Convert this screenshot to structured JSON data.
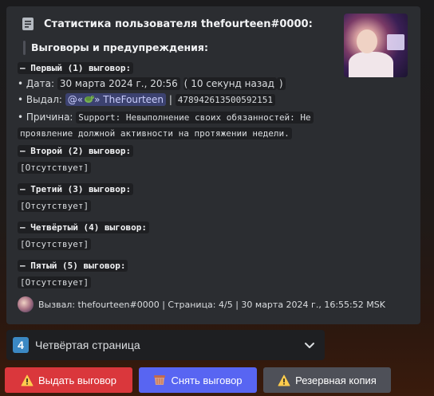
{
  "embed": {
    "author": "Статистика пользователя thefourteen#0000:",
    "subtitle": "Выговоры и предупреждения:",
    "first": {
      "header": "— Первый (1) выговор:",
      "date_prefix": "• Дата: ",
      "date_value": "30 марта 2024 г., 20:56",
      "date_relative": "10 секунд назад",
      "issued_prefix": "• Выдал: ",
      "issued_mention_prefix": "@«",
      "issued_mention_name": "» TheFourteen",
      "issued_id": "478942613500592151",
      "reason_prefix": "• Причина: ",
      "reason_line1": "Support: Невыполнение своих обязанностей: Не",
      "reason_line2": "проявление должной активности на протяжении недели."
    },
    "second": {
      "header": "— Второй (2) выговор:",
      "value": "[Отсутствует]"
    },
    "third": {
      "header": "— Третий (3) выговор:",
      "value": "[Отсутствует]"
    },
    "fourth": {
      "header": "— Четвёртый (4) выговор:",
      "value": "[Отсутствует]"
    },
    "fifth": {
      "header": "— Пятый (5) выговор:",
      "value": "[Отсутствует]"
    },
    "footer": "Вызвал: thefourteen#0000 | Страница: 4/5 | 30 марта 2024 г., 16:55:52 MSK"
  },
  "select": {
    "number": "4",
    "label": "Четвёртая страница"
  },
  "buttons": {
    "issue": "Выдать выговор",
    "remove": "Снять выговор",
    "backup": "Резервная копия"
  },
  "colors": {
    "embed_bg": "#2b2d31",
    "danger": "#da373c",
    "primary": "#5865f2",
    "secondary": "#4e5058",
    "number_badge": "#3b88c3"
  },
  "icons": [
    "document-icon",
    "turtle-emoji-icon",
    "chevron-down-icon",
    "warning-icon",
    "basket-icon"
  ]
}
